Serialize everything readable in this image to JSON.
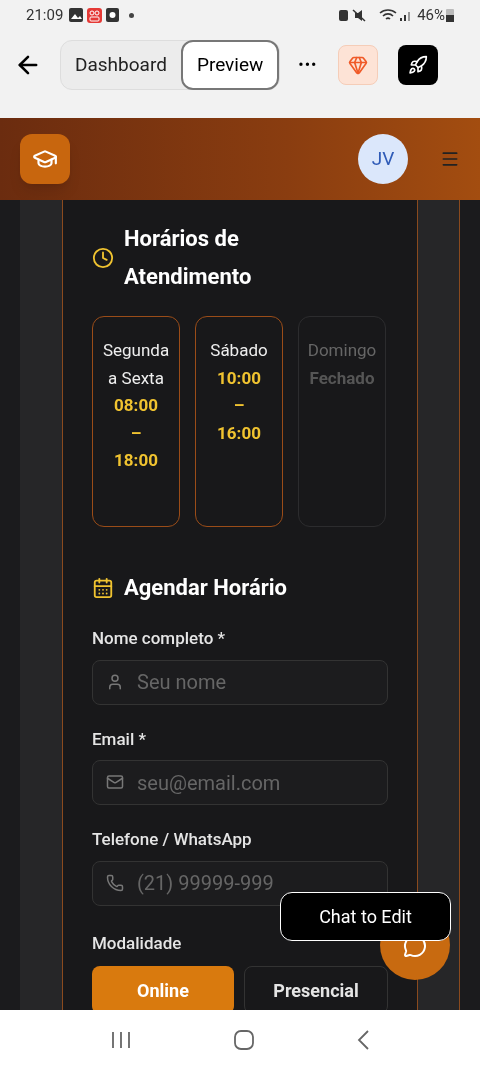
{
  "status_bar": {
    "time": "21:09",
    "battery": "46%"
  },
  "toolbar": {
    "tabs": [
      {
        "label": "Dashboard",
        "selected": false
      },
      {
        "label": "Preview",
        "selected": true
      }
    ],
    "more": "•••"
  },
  "header": {
    "avatar": "JV"
  },
  "hours": {
    "title": "Horários de Atendimento",
    "days": [
      {
        "day": "Segunda a Sexta",
        "time": "08:00 – 18:00",
        "closed": false
      },
      {
        "day": "Sábado",
        "time": "10:00 – 16:00",
        "closed": false
      },
      {
        "day": "Domingo",
        "time": "Fechado",
        "closed": true
      }
    ]
  },
  "booking": {
    "title": "Agendar Horário",
    "fields": [
      {
        "kind": "name",
        "label": "Nome completo *",
        "placeholder": "Seu nome"
      },
      {
        "kind": "email",
        "label": "Email *",
        "placeholder": "seu@email.com"
      },
      {
        "kind": "phone",
        "label": "Telefone / WhatsApp",
        "placeholder": "(21) 99999-999"
      }
    ],
    "modality": {
      "label": "Modalidade",
      "options": [
        {
          "label": "Online",
          "selected": true
        },
        {
          "label": "Presencial",
          "selected": false
        }
      ]
    }
  },
  "chat_tooltip": "Chat to Edit"
}
